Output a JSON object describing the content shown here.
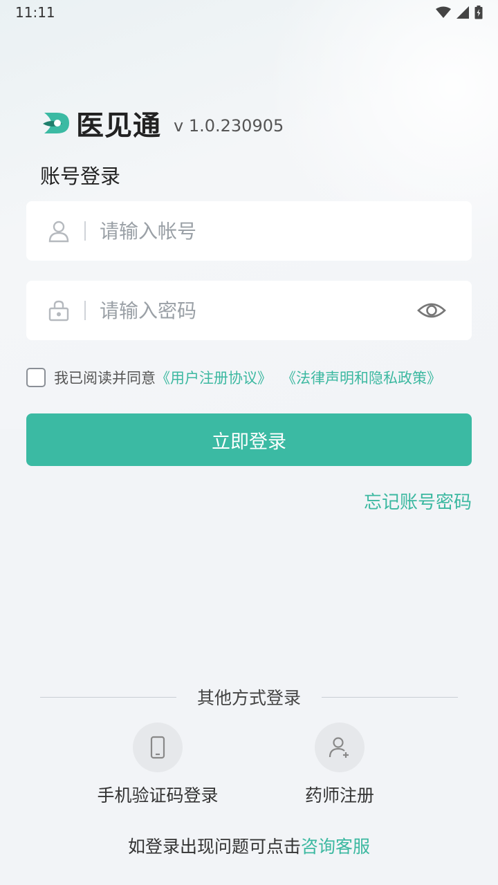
{
  "status_bar": {
    "time": "11:11"
  },
  "brand": {
    "name": "医见通",
    "version": "v 1.0.230905"
  },
  "login": {
    "title": "账号登录",
    "account_placeholder": "请输入帐号",
    "password_placeholder": "请输入密码",
    "agree_prefix": "我已阅读并同意",
    "terms_link": "《用户注册协议》",
    "privacy_link": "《法律声明和隐私政策》",
    "submit_label": "立即登录",
    "forgot_label": "忘记账号密码"
  },
  "other_methods": {
    "title": "其他方式登录",
    "items": [
      {
        "label": "手机验证码登录",
        "icon": "phone-icon"
      },
      {
        "label": "药师注册",
        "icon": "add-user-icon"
      }
    ]
  },
  "help": {
    "prefix": "如登录出现问题可点击",
    "link": "咨询客服"
  },
  "colors": {
    "accent": "#3bbaa3",
    "link": "#3bb8a0",
    "background": "#f2f4f7"
  }
}
